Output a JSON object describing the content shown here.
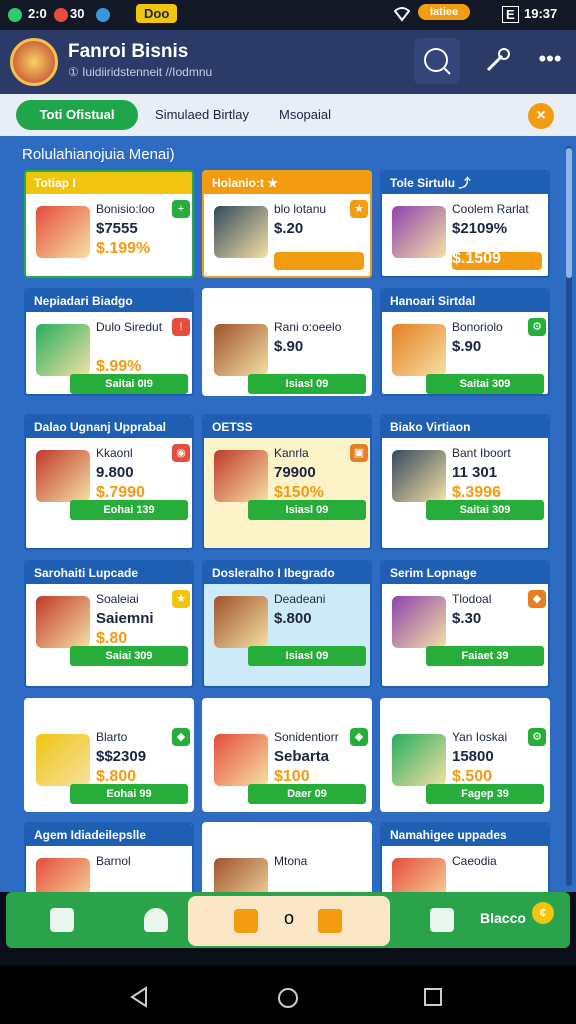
{
  "status": {
    "time_left": "2:0",
    "num_a": "30",
    "app_chip": "Doo",
    "pill_text": "Iatiee",
    "box_label": "E",
    "clock": "19:37"
  },
  "header": {
    "title": "Fanroi Bisnis",
    "subtitle": "① Iuidiiridstenneit //Iodmnu"
  },
  "tabs": [
    {
      "label": "Toti Ofistual",
      "active": true
    },
    {
      "label": "Simulaed Birtlay",
      "active": false
    },
    {
      "label": "Msopaial",
      "active": false
    }
  ],
  "section_title": "Rolulahianojuia Menai)",
  "cards": [
    {
      "id": "c1",
      "header": "Totiap I",
      "name": "Bonisio:loo",
      "price1": "$7555",
      "price2": "$.199%",
      "button": "",
      "accent": "#e74c3c",
      "badge": "+",
      "badge_color": "#27ae3a",
      "bg": "#fff",
      "header_bg": "#f1c40f",
      "has_bar": false,
      "outline": "#27ae3a"
    },
    {
      "id": "c2",
      "header": "Holanio:t ★",
      "name": "blo lotanu",
      "price1": "$.20",
      "price2": "",
      "button": "",
      "accent": "#34495e",
      "badge": "★",
      "badge_color": "#f39c12",
      "bg": "#fff",
      "header_bg": "#f39c12",
      "has_bar": true,
      "outline": "#f39c12"
    },
    {
      "id": "c3",
      "header": "Tole Sirtulu ⤴",
      "name": "Coolem Rarlat",
      "price1": "$2109%",
      "price2": "$.1509",
      "button": "",
      "accent": "#8e44ad",
      "badge": "",
      "badge_color": "",
      "bg": "#fff",
      "header_bg": "#1f5fb3",
      "has_bar": true,
      "outline": "#1f5fb3"
    },
    {
      "id": "c4",
      "header": "Nepiadari Biadgo",
      "name": "Dulo Siredut",
      "price1": "",
      "price2": "$.99%",
      "button": "Saitai 0I9",
      "accent": "#27ae60",
      "badge": "!",
      "badge_color": "#e74c3c",
      "bg": "#fff",
      "header_bg": "#1f5fb3",
      "has_bar": false,
      "outline": "#1f5fb3"
    },
    {
      "id": "c5",
      "header": "",
      "name": "Rani o:oeelo",
      "price1": "$.90",
      "price2": "",
      "button": "Isiasl 09",
      "accent": "#a0522d",
      "badge": "",
      "badge_color": "",
      "bg": "#fff",
      "header_bg": "#2e6cc4",
      "has_bar": false,
      "outline": "#fff"
    },
    {
      "id": "c6",
      "header": "Hanoari Sirtdal",
      "name": "Bonoriolo",
      "price1": "$.90",
      "price2": "",
      "button": "Saitai 309",
      "accent": "#e67e22",
      "badge": "⚙",
      "badge_color": "#27ae3a",
      "bg": "#fff",
      "header_bg": "#1f5fb3",
      "has_bar": false,
      "outline": "#1f5fb3"
    },
    {
      "id": "c7",
      "header": "Dalao Ugnanj Upprabal",
      "name": "Kkaonl",
      "price1": "9.800",
      "price2": "$.7990",
      "button": "Eohai 139",
      "accent": "#c0392b",
      "badge": "◉",
      "badge_color": "#e74c3c",
      "bg": "#fff",
      "header_bg": "#1f5fb3",
      "has_bar": false,
      "outline": "#1f5fb3"
    },
    {
      "id": "c8",
      "header": "OETSS",
      "name": "Kanrla",
      "price1": "79900",
      "price2": "$150%",
      "button": "Isiasl 09",
      "accent": "#c0392b",
      "badge": "▣",
      "badge_color": "#e67e22",
      "bg": "#fdf3c9",
      "header_bg": "#1f5fb3",
      "has_bar": false,
      "outline": "#1f5fb3"
    },
    {
      "id": "c9",
      "header": "Biako Virtiaon",
      "name": "Bant Iboort",
      "price1": "11 301",
      "price2": "$.3996",
      "button": "Saitai 309",
      "accent": "#34495e",
      "badge": "",
      "badge_color": "",
      "bg": "#fff",
      "header_bg": "#1f5fb3",
      "has_bar": false,
      "outline": "#1f5fb3"
    },
    {
      "id": "c10",
      "header": "Sarohaiti Lupcade",
      "name": "Soaleiai",
      "price1": "Saiemni",
      "price2": "$.80",
      "button": "Saiai 309",
      "accent": "#c0392b",
      "badge": "★",
      "badge_color": "#f1c40f",
      "bg": "#fff",
      "header_bg": "#1f5fb3",
      "has_bar": false,
      "outline": "#1f5fb3"
    },
    {
      "id": "c11",
      "header": "Dosleralho I Ibegrado",
      "name": "Deadeani",
      "price1": "$.800",
      "price2": "",
      "button": "Isiasl 09",
      "accent": "#a0522d",
      "badge": "",
      "badge_color": "",
      "bg": "#cdeaf8",
      "header_bg": "#1f5fb3",
      "has_bar": false,
      "outline": "#1f5fb3"
    },
    {
      "id": "c12",
      "header": "Serim Lopnage",
      "name": "Tlodoal",
      "price1": "$.30",
      "price2": "",
      "button": "Faiaet 39",
      "accent": "#8e44ad",
      "badge": "◆",
      "badge_color": "#e67e22",
      "bg": "#fff",
      "header_bg": "#1f5fb3",
      "has_bar": false,
      "outline": "#1f5fb3"
    },
    {
      "id": "c13",
      "header": "",
      "name": "Blarto",
      "price1": "$$2309",
      "price2": "$.800",
      "button": "Eohai 99",
      "accent": "#f1c40f",
      "badge": "◆",
      "badge_color": "#27ae3a",
      "bg": "#fff",
      "header_bg": "#2e6cc4",
      "has_bar": false,
      "outline": "#fff"
    },
    {
      "id": "c14",
      "header": "",
      "name": "Sonidentiorr",
      "price1": "Sebarta",
      "price2": "$100",
      "button": "Daer 09",
      "accent": "#e74c3c",
      "badge": "◆",
      "badge_color": "#27ae3a",
      "bg": "#fff",
      "header_bg": "#2e6cc4",
      "has_bar": false,
      "outline": "#fff"
    },
    {
      "id": "c15",
      "header": "",
      "name": "Yan Ioskai",
      "price1": "15800",
      "price2": "$.500",
      "button": "Fagep 39",
      "accent": "#27ae60",
      "badge": "⚙",
      "badge_color": "#27ae3a",
      "bg": "#fff",
      "header_bg": "#2e6cc4",
      "has_bar": false,
      "outline": "#fff"
    },
    {
      "id": "c16",
      "header": "Agem Idiadeilepslle",
      "name": "Barnol",
      "price1": "",
      "price2": "",
      "button": "",
      "accent": "#e74c3c",
      "badge": "",
      "badge_color": "",
      "bg": "#fff",
      "header_bg": "#1f5fb3",
      "has_bar": false,
      "outline": "#1f5fb3"
    },
    {
      "id": "c17",
      "header": "",
      "name": "Mtona",
      "price1": "",
      "price2": "",
      "button": "",
      "accent": "#a0522d",
      "badge": "",
      "badge_color": "",
      "bg": "#fff",
      "header_bg": "#2e6cc4",
      "has_bar": false,
      "outline": "#fff"
    },
    {
      "id": "c18",
      "header": "Namahigee uppades",
      "name": "Caeodia",
      "price1": "",
      "price2": "",
      "button": "",
      "accent": "#e74c3c",
      "badge": "",
      "badge_color": "",
      "bg": "#fff",
      "header_bg": "#1f5fb3",
      "has_bar": false,
      "outline": "#1f5fb3"
    }
  ],
  "bottom_nav": {
    "center_label": "o",
    "right_label": "Blacco",
    "coin": "¢"
  }
}
